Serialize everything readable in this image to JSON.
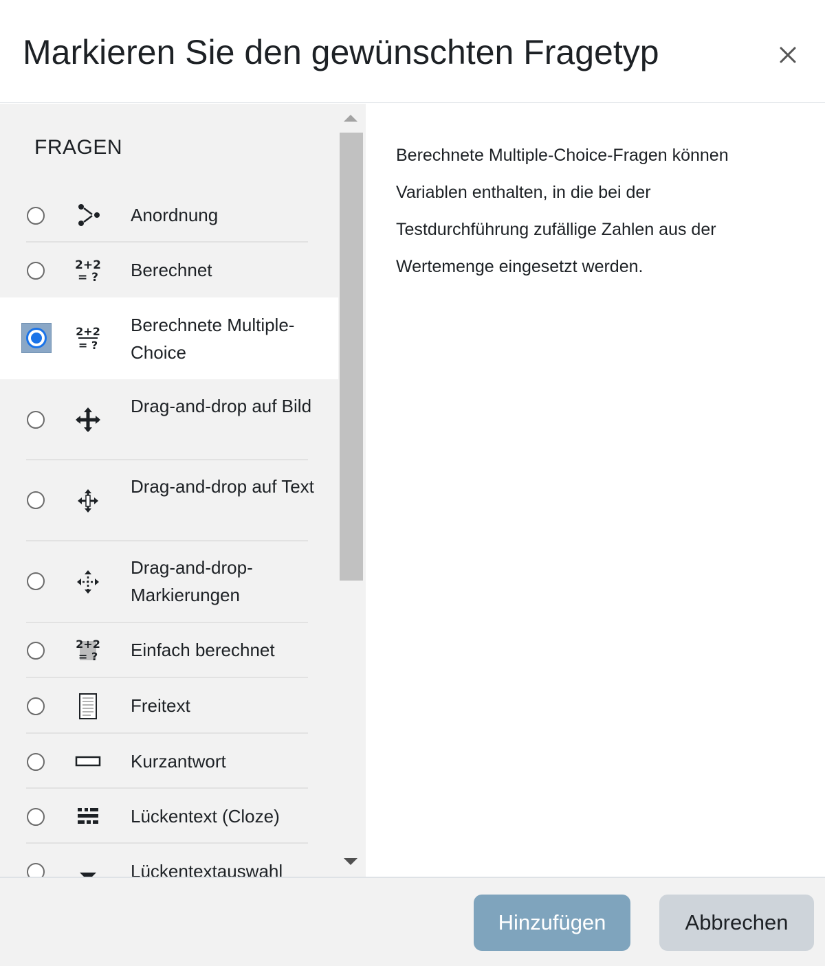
{
  "dialog": {
    "title": "Markieren Sie den gewünschten Fragetyp",
    "close_label": "×"
  },
  "options_panel": {
    "heading": "FRAGEN",
    "items": [
      {
        "label": "Anordnung",
        "icon": "ordering-icon",
        "selected": false
      },
      {
        "label": "Berechnet",
        "icon": "calculated-icon",
        "selected": false
      },
      {
        "label": "Berechnete Multiple-Choice",
        "icon": "calculated-multichoice-icon",
        "selected": true
      },
      {
        "label": "Drag-and-drop auf Bild",
        "icon": "drag-drop-image-icon",
        "selected": false
      },
      {
        "label": "Drag-and-drop auf Text",
        "icon": "drag-drop-text-icon",
        "selected": false
      },
      {
        "label": "Drag-and-drop-Markierungen",
        "icon": "drag-drop-markers-icon",
        "selected": false
      },
      {
        "label": "Einfach berechnet",
        "icon": "calculated-simple-icon",
        "selected": false
      },
      {
        "label": "Freitext",
        "icon": "essay-icon",
        "selected": false
      },
      {
        "label": "Kurzantwort",
        "icon": "short-answer-icon",
        "selected": false
      },
      {
        "label": "Lückentext (Cloze)",
        "icon": "cloze-icon",
        "selected": false
      },
      {
        "label": "Lückentextauswahl",
        "icon": "select-missing-words-icon",
        "selected": false
      }
    ]
  },
  "details": {
    "description": "Berechnete Multiple-Choice-Fragen können Variablen enthalten, in die bei der Testdurchführung zufällige Zahlen aus der Wertemenge eingesetzt werden."
  },
  "footer": {
    "add_label": "Hinzufügen",
    "cancel_label": "Abbrechen"
  },
  "colors": {
    "add_button": "#7fa4bd",
    "cancel_button": "#ced4da",
    "selected_radio": "#1a73e8",
    "panel_bg": "#f2f2f2"
  }
}
